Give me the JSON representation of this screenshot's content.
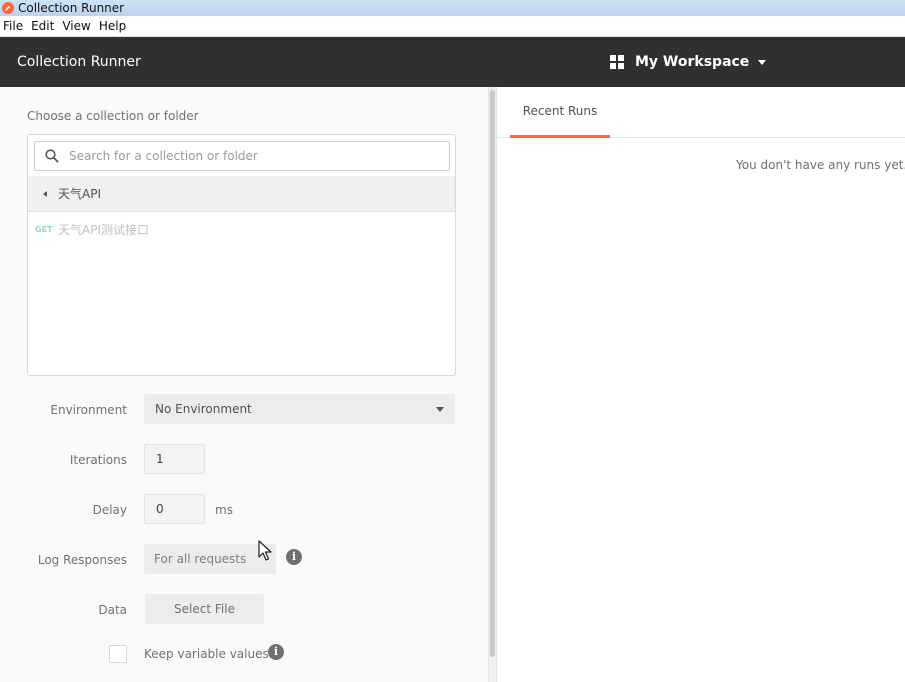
{
  "window": {
    "title": "Collection Runner"
  },
  "menu": {
    "items": [
      "File",
      "Edit",
      "View",
      "Help"
    ]
  },
  "header": {
    "title": "Collection Runner",
    "workspace_label": "My Workspace"
  },
  "collection_picker": {
    "label": "Choose a collection or folder",
    "search_placeholder": "Search for a collection or folder",
    "breadcrumb": "天气API",
    "requests": [
      {
        "method": "GET",
        "name": "天气API测试接口"
      }
    ]
  },
  "settings": {
    "environment": {
      "label": "Environment",
      "value": "No Environment"
    },
    "iterations": {
      "label": "Iterations",
      "value": "1"
    },
    "delay": {
      "label": "Delay",
      "value": "0",
      "unit": "ms"
    },
    "log_responses": {
      "label": "Log Responses",
      "value": "For all requests"
    },
    "data": {
      "label": "Data",
      "button": "Select File"
    },
    "keep_variables": {
      "label": "Keep variable values"
    }
  },
  "runs": {
    "tab": "Recent Runs",
    "empty_message": "You don't have any runs yet. S"
  },
  "colors": {
    "accent": "#f26b3a",
    "header_bg": "#303030",
    "method_get": "#9bd7b4"
  }
}
